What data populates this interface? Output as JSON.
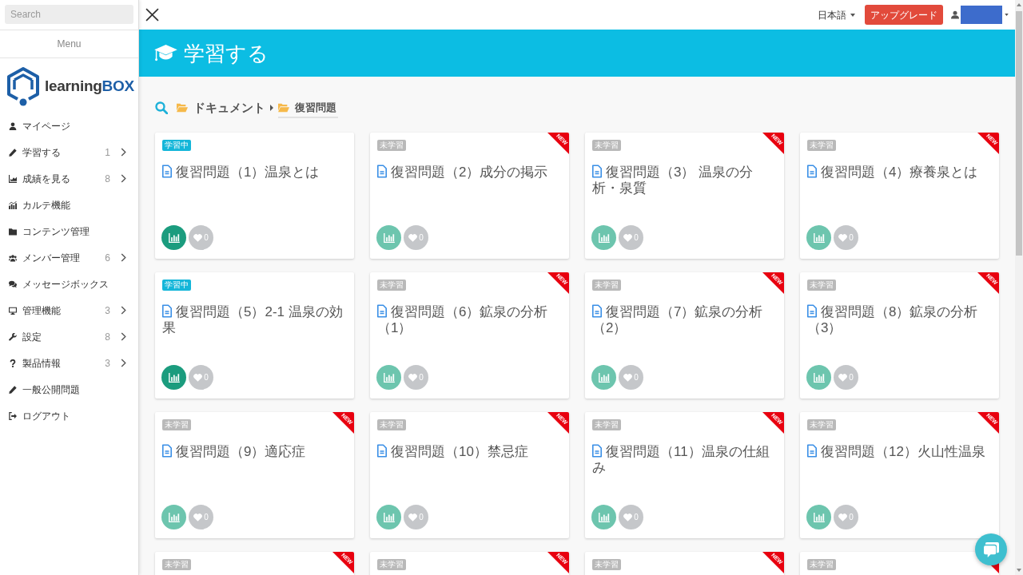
{
  "sidebar": {
    "search": {
      "placeholder": "Search"
    },
    "menu_heading": "Menu",
    "logo": {
      "text": "learning",
      "accent": "BOX"
    },
    "items": [
      {
        "label": "マイページ",
        "expandable": false
      },
      {
        "label": "学習する",
        "count": "1",
        "expandable": true
      },
      {
        "label": "成績を見る",
        "count": "8",
        "expandable": true
      },
      {
        "label": "カルテ機能",
        "expandable": false
      },
      {
        "label": "コンテンツ管理",
        "expandable": false
      },
      {
        "label": "メンバー管理",
        "count": "6",
        "expandable": true
      },
      {
        "label": "メッセージボックス",
        "expandable": false
      },
      {
        "label": "管理機能",
        "count": "3",
        "expandable": true
      },
      {
        "label": "設定",
        "count": "8",
        "expandable": true
      },
      {
        "label": "製品情報",
        "count": "3",
        "expandable": true
      },
      {
        "label": "一般公開問題",
        "expandable": false
      },
      {
        "label": "ログアウト",
        "expandable": false
      }
    ]
  },
  "topbar": {
    "language": "日本語",
    "upgrade_button": "アップグレード"
  },
  "header": {
    "title": "学習する"
  },
  "breadcrumb": [
    {
      "label": "ドキュメント",
      "current": false
    },
    {
      "label": "復習問題",
      "current": true
    }
  ],
  "cards": [
    {
      "status": "学習中",
      "kind": "studying",
      "new": false,
      "title": "復習問題（1）温泉とは",
      "likes": "0"
    },
    {
      "status": "未学習",
      "kind": "unstudied",
      "new": true,
      "ribbon_label": "NEW",
      "title": "復習問題（2）成分の掲示",
      "likes": "0"
    },
    {
      "status": "未学習",
      "kind": "unstudied",
      "new": true,
      "ribbon_label": "NEW",
      "title": "復習問題（3） 温泉の分析・泉質",
      "likes": "0"
    },
    {
      "status": "未学習",
      "kind": "unstudied",
      "new": true,
      "ribbon_label": "NEW",
      "title": "復習問題（4）療養泉とは",
      "likes": "0"
    },
    {
      "status": "学習中",
      "kind": "studying",
      "new": false,
      "title": "復習問題（5）2-1 温泉の効果",
      "likes": "0"
    },
    {
      "status": "未学習",
      "kind": "unstudied",
      "new": true,
      "ribbon_label": "NEW",
      "title": "復習問題（6）鉱泉の分析（1）",
      "likes": "0"
    },
    {
      "status": "未学習",
      "kind": "unstudied",
      "new": true,
      "ribbon_label": "NEW",
      "title": "復習問題（7）鉱泉の分析（2）",
      "likes": "0"
    },
    {
      "status": "未学習",
      "kind": "unstudied",
      "new": true,
      "ribbon_label": "NEW",
      "title": "復習問題（8）鉱泉の分析（3）",
      "likes": "0"
    },
    {
      "status": "未学習",
      "kind": "unstudied",
      "new": true,
      "ribbon_label": "NEW",
      "title": "復習問題（9）適応症",
      "likes": "0"
    },
    {
      "status": "未学習",
      "kind": "unstudied",
      "new": true,
      "ribbon_label": "NEW",
      "title": "復習問題（10）禁忌症",
      "likes": "0"
    },
    {
      "status": "未学習",
      "kind": "unstudied",
      "new": true,
      "ribbon_label": "NEW",
      "title": "復習問題（11）温泉の仕組み",
      "likes": "0"
    },
    {
      "status": "未学習",
      "kind": "unstudied",
      "new": true,
      "ribbon_label": "NEW",
      "title": "復習問題（12）火山性温泉",
      "likes": "0"
    },
    {
      "status": "未学習",
      "kind": "unstudied",
      "new": true,
      "ribbon_label": "NEW"
    },
    {
      "status": "未学習",
      "kind": "unstudied",
      "new": true,
      "ribbon_label": "NEW"
    },
    {
      "status": "未学習",
      "kind": "unstudied",
      "new": true,
      "ribbon_label": "NEW"
    },
    {
      "status": "未学習",
      "kind": "unstudied",
      "new": true
    }
  ]
}
